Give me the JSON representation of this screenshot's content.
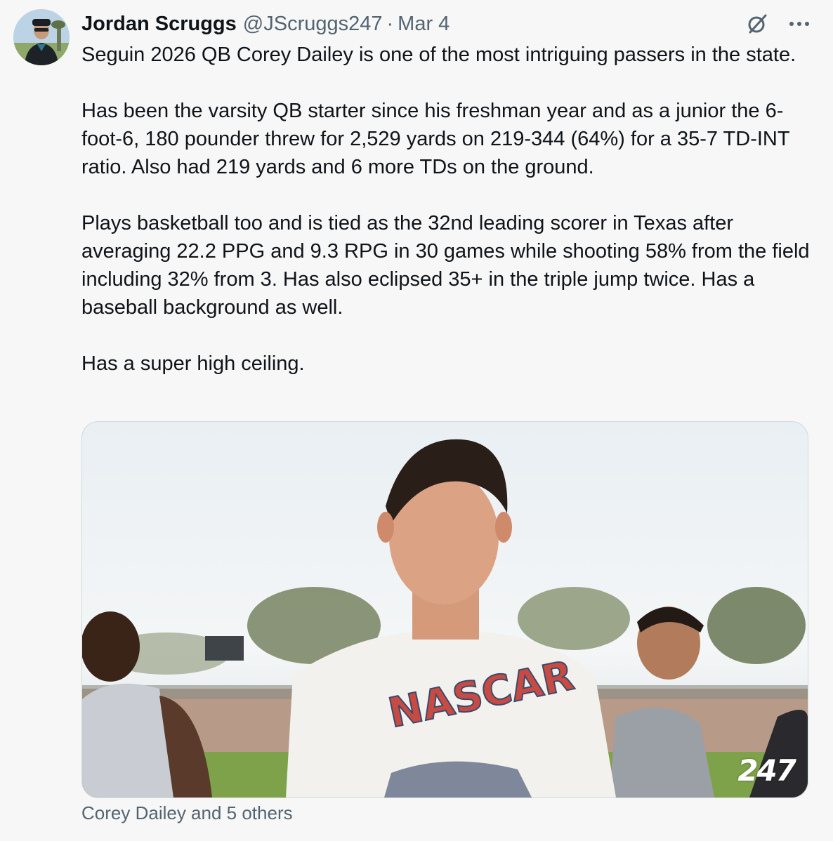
{
  "author": {
    "name": "Jordan Scruggs",
    "handle": "@JScruggs247",
    "separator": "·",
    "date": "Mar 4"
  },
  "icons": {
    "grok": "grok-icon",
    "more": "more-icon"
  },
  "tweet": {
    "paragraphs": [
      "Seguin 2026 QB Corey Dailey is one of the most intriguing passers in the state.",
      "Has been the varsity QB starter since his freshman year and as a junior the 6-foot-6, 180 pounder threw for 2,529 yards on 219-344 (64%) for a 35-7 TD-INT ratio. Also had 219 yards and 6 more TDs on the ground.",
      "Plays basketball too and is tied as the 32nd leading scorer in Texas after averaging 22.2 PPG and 9.3 RPG in 30 games while shooting 58% from the field including 32% from 3. Has also eclipsed 35+ in the triple jump twice. Has a baseball background as well.",
      "Has a super high ceiling."
    ]
  },
  "media": {
    "watermark": "247",
    "shirt_text": "NASCAR"
  },
  "tags": {
    "label": "Corey Dailey and 5 others"
  },
  "colors": {
    "text_primary": "#0f1419",
    "text_secondary": "#536471",
    "background": "#f7f7f7",
    "media_border": "#cfd9de"
  }
}
